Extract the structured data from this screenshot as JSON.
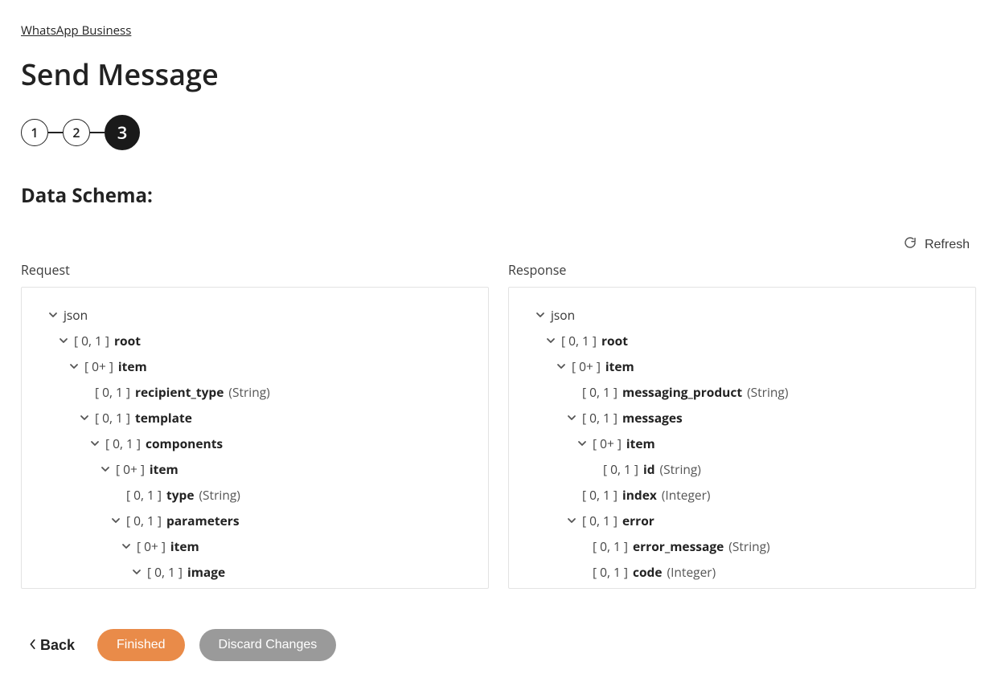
{
  "breadcrumb": "WhatsApp Business",
  "title": "Send Message",
  "steps": [
    "1",
    "2",
    "3"
  ],
  "activeStep": 2,
  "sectionHeading": "Data Schema:",
  "refresh": "Refresh",
  "requestLabel": "Request",
  "responseLabel": "Response",
  "back": "Back",
  "finished": "Finished",
  "discard": "Discard Changes",
  "jsonLabel": "json",
  "requestTree": [
    {
      "indent": 0,
      "chev": true,
      "card": "",
      "name": "json",
      "nameBold": false
    },
    {
      "indent": 1,
      "chev": true,
      "card": "[ 0, 1 ]",
      "name": "root"
    },
    {
      "indent": 2,
      "chev": true,
      "card": "[ 0+ ]",
      "name": "item"
    },
    {
      "indent": 3,
      "chev": false,
      "card": "[ 0, 1 ]",
      "name": "recipient_type",
      "type": "(String)"
    },
    {
      "indent": 3,
      "chev": true,
      "card": "[ 0, 1 ]",
      "name": "template"
    },
    {
      "indent": 4,
      "chev": true,
      "card": "[ 0, 1 ]",
      "name": "components"
    },
    {
      "indent": 5,
      "chev": true,
      "card": "[ 0+ ]",
      "name": "item"
    },
    {
      "indent": 6,
      "chev": false,
      "card": "[ 0, 1 ]",
      "name": "type",
      "type": "(String)"
    },
    {
      "indent": 6,
      "chev": true,
      "card": "[ 0, 1 ]",
      "name": "parameters"
    },
    {
      "indent": 7,
      "chev": true,
      "card": "[ 0+ ]",
      "name": "item"
    },
    {
      "indent": 8,
      "chev": true,
      "card": "[ 0, 1 ]",
      "name": "image"
    }
  ],
  "responseTree": [
    {
      "indent": 0,
      "chev": true,
      "card": "",
      "name": "json",
      "nameBold": false
    },
    {
      "indent": 1,
      "chev": true,
      "card": "[ 0, 1 ]",
      "name": "root"
    },
    {
      "indent": 2,
      "chev": true,
      "card": "[ 0+ ]",
      "name": "item"
    },
    {
      "indent": 3,
      "chev": false,
      "card": "[ 0, 1 ]",
      "name": "messaging_product",
      "type": "(String)"
    },
    {
      "indent": 3,
      "chev": true,
      "card": "[ 0, 1 ]",
      "name": "messages"
    },
    {
      "indent": 4,
      "chev": true,
      "card": "[ 0+ ]",
      "name": "item"
    },
    {
      "indent": 5,
      "chev": false,
      "card": "[ 0, 1 ]",
      "name": "id",
      "type": "(String)"
    },
    {
      "indent": 3,
      "chev": false,
      "card": "[ 0, 1 ]",
      "name": "index",
      "type": "(Integer)"
    },
    {
      "indent": 3,
      "chev": true,
      "card": "[ 0, 1 ]",
      "name": "error"
    },
    {
      "indent": 4,
      "chev": false,
      "card": "[ 0, 1 ]",
      "name": "error_message",
      "type": "(String)"
    },
    {
      "indent": 4,
      "chev": false,
      "card": "[ 0, 1 ]",
      "name": "code",
      "type": "(Integer)"
    }
  ]
}
